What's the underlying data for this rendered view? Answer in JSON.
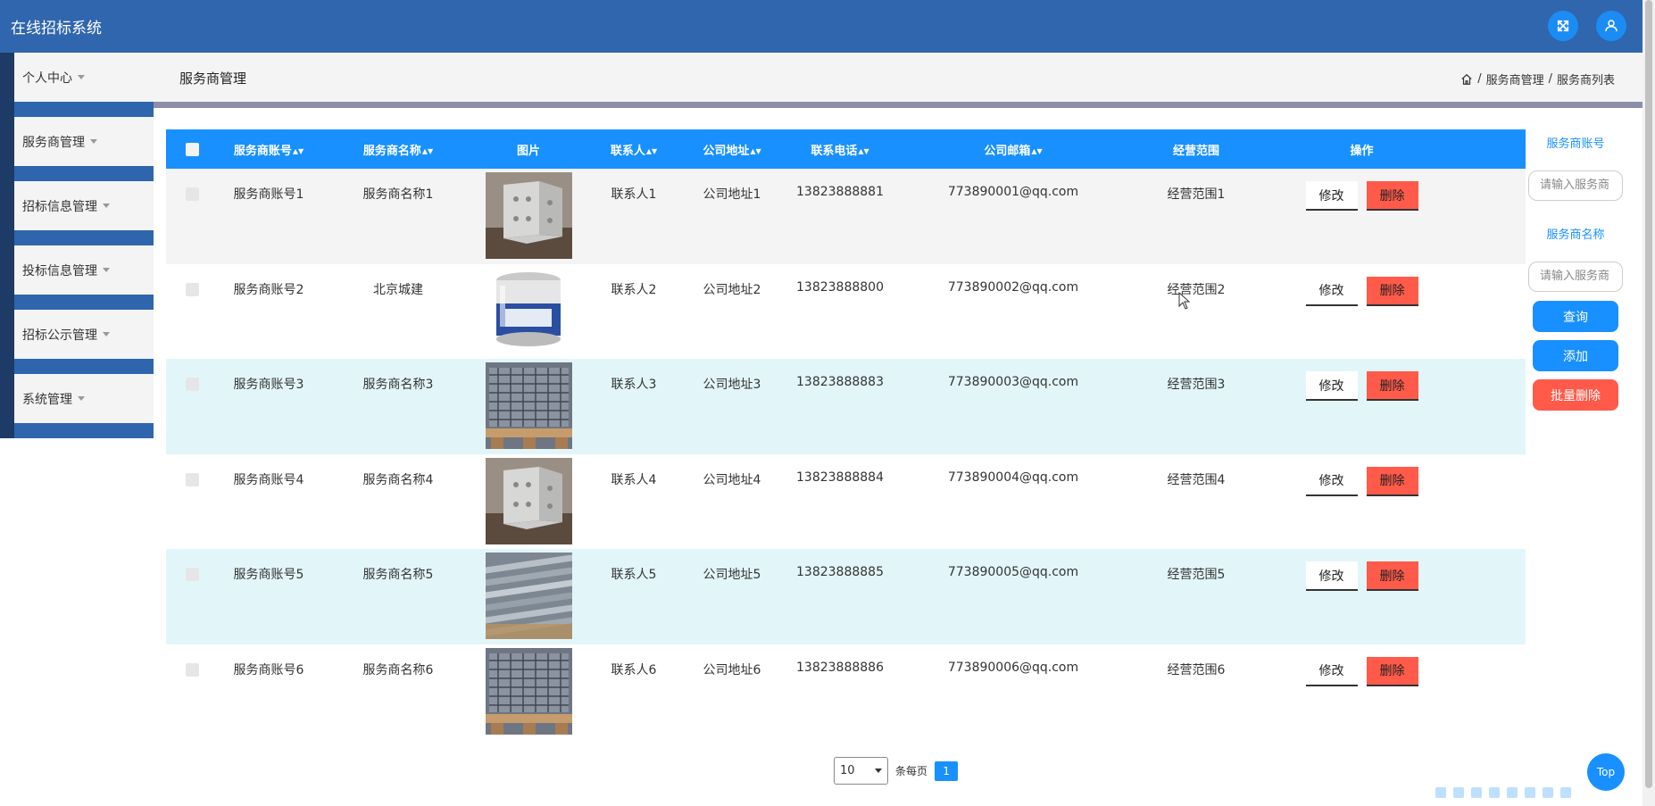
{
  "app": {
    "title": "在线招标系统"
  },
  "colors": {
    "header": "#3066ad",
    "accent": "#1890ff",
    "danger": "#ff5a4a"
  },
  "header_icons": [
    "fullscreen-icon",
    "user-icon"
  ],
  "sidebar": {
    "items": [
      {
        "label": "个人中心"
      },
      {
        "label": "服务商管理"
      },
      {
        "label": "招标信息管理"
      },
      {
        "label": "投标信息管理"
      },
      {
        "label": "招标公示管理"
      },
      {
        "label": "系统管理"
      }
    ]
  },
  "page": {
    "title": "服务商管理",
    "breadcrumb": [
      "服务商管理",
      "服务商列表"
    ]
  },
  "table": {
    "columns": [
      "服务商账号",
      "服务商名称",
      "图片",
      "联系人",
      "公司地址",
      "联系电话",
      "公司邮箱",
      "经营范围",
      "操作"
    ],
    "rows": [
      {
        "account": "服务商账号1",
        "name": "服务商名称1",
        "image": "metal-bracket",
        "contact": "联系人1",
        "address": "公司地址1",
        "phone": "13823888881",
        "email": "773890001@qq.com",
        "scope": "经营范围1"
      },
      {
        "account": "服务商账号2",
        "name": "北京城建",
        "image": "paint-bucket",
        "contact": "联系人2",
        "address": "公司地址2",
        "phone": "13823888800",
        "email": "773890002@qq.com",
        "scope": "经营范围2"
      },
      {
        "account": "服务商账号3",
        "name": "服务商名称3",
        "image": "wire-mesh-pallet",
        "contact": "联系人3",
        "address": "公司地址3",
        "phone": "13823888883",
        "email": "773890003@qq.com",
        "scope": "经营范围3"
      },
      {
        "account": "服务商账号4",
        "name": "服务商名称4",
        "image": "metal-bracket",
        "contact": "联系人4",
        "address": "公司地址4",
        "phone": "13823888884",
        "email": "773890004@qq.com",
        "scope": "经营范围4"
      },
      {
        "account": "服务商账号5",
        "name": "服务商名称5",
        "image": "steel-angles",
        "contact": "联系人5",
        "address": "公司地址5",
        "phone": "13823888885",
        "email": "773890005@qq.com",
        "scope": "经营范围5"
      },
      {
        "account": "服务商账号6",
        "name": "服务商名称6",
        "image": "wire-mesh-pallet",
        "contact": "联系人6",
        "address": "公司地址6",
        "phone": "13823888886",
        "email": "773890006@qq.com",
        "scope": "经营范围6"
      }
    ],
    "edit_label": "修改",
    "delete_label": "删除"
  },
  "search": {
    "account_label": "服务商账号",
    "account_placeholder": "请输入服务商",
    "name_label": "服务商名称",
    "name_placeholder": "请输入服务商",
    "query_label": "查询",
    "add_label": "添加",
    "batch_delete_label": "批量删除"
  },
  "pagination": {
    "page_size": "10",
    "per_page_label": "条每页",
    "current_page": "1"
  },
  "top_button": {
    "label": "Top"
  }
}
